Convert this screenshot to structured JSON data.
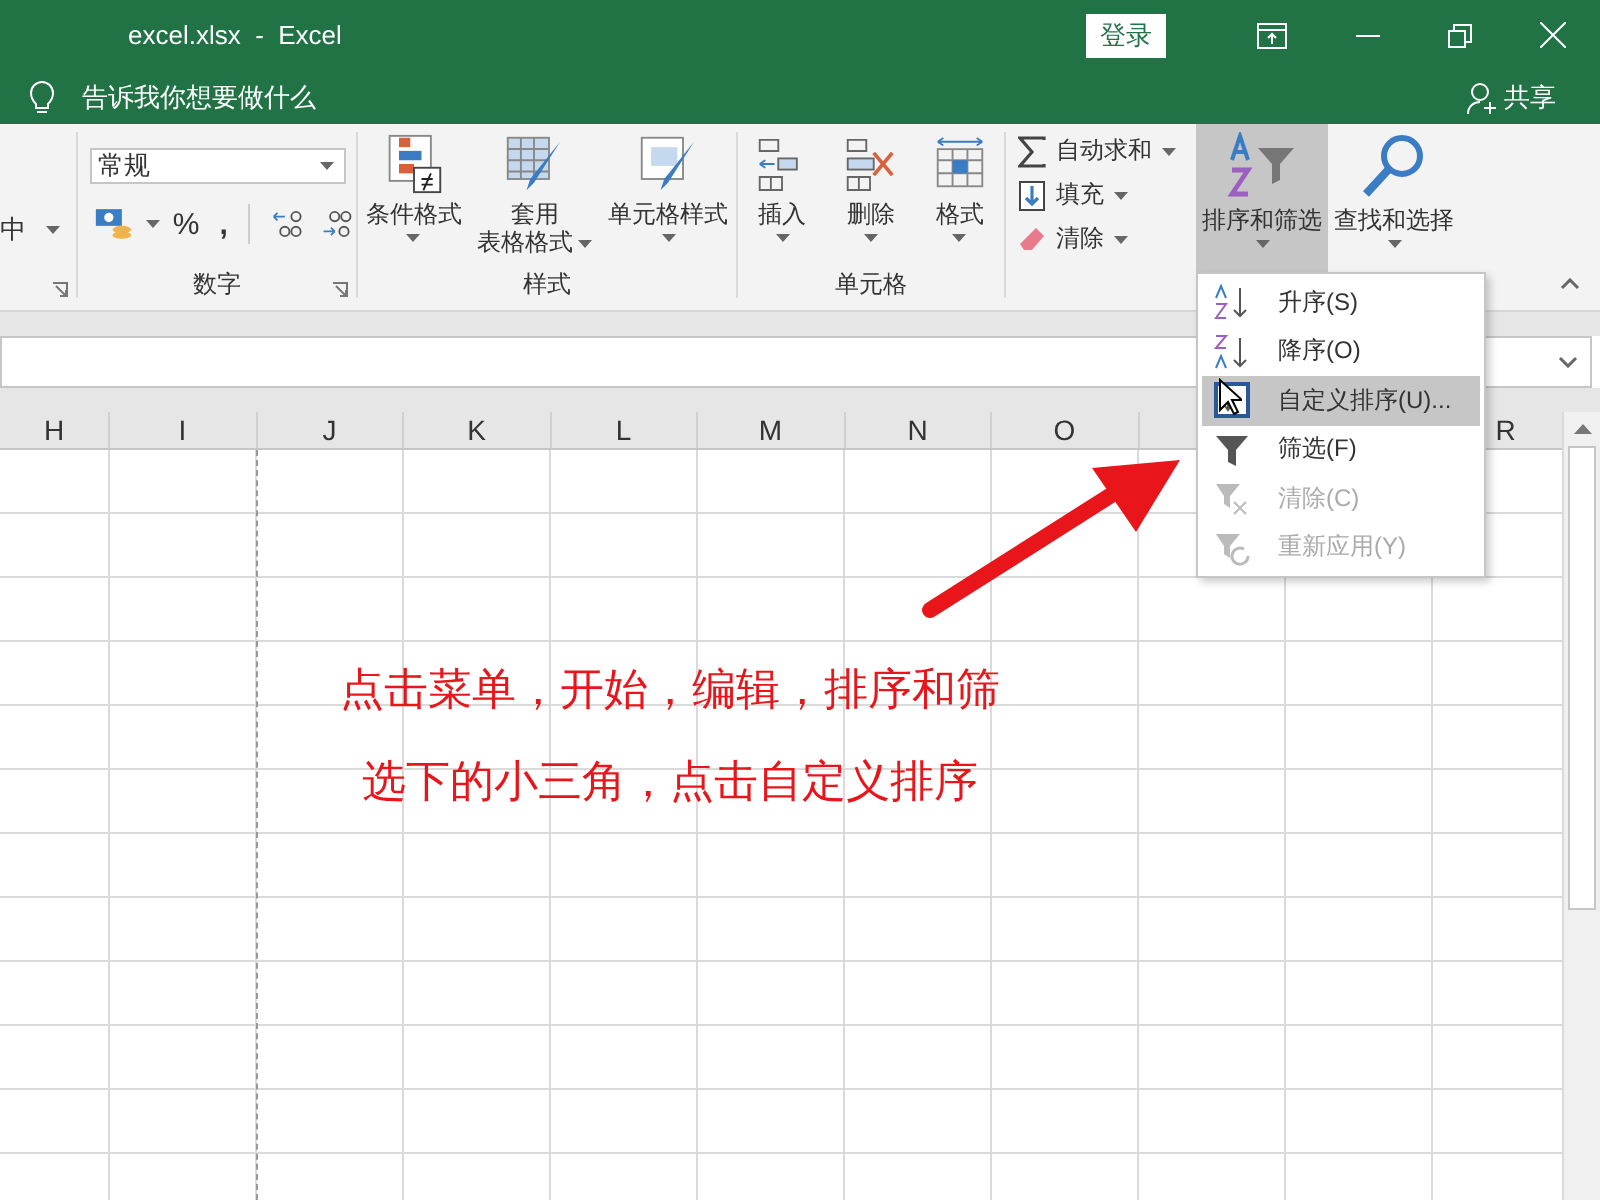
{
  "window": {
    "title": "excel.xlsx  -  Excel",
    "login_button": "登录"
  },
  "tell_me": {
    "placeholder": "告诉我你想要做什么",
    "share": "共享"
  },
  "ribbon": {
    "partial_group": {
      "label": "中"
    },
    "number_group": {
      "label": "数字",
      "format": "常规",
      "percent": "%",
      "comma": ","
    },
    "styles_group": {
      "label": "样式",
      "buttons": [
        {
          "lines": [
            "条件格式"
          ],
          "kind": "conditional"
        },
        {
          "lines": [
            "套用",
            "表格格式"
          ],
          "kind": "table"
        },
        {
          "lines": [
            "单元格样式"
          ],
          "kind": "cellstyle"
        }
      ]
    },
    "cells_group": {
      "label": "单元格",
      "buttons": [
        {
          "lines": [
            "插入"
          ],
          "kind": "insert"
        },
        {
          "lines": [
            "删除"
          ],
          "kind": "delete"
        },
        {
          "lines": [
            "格式"
          ],
          "kind": "format"
        }
      ]
    },
    "editing_group": {
      "small_buttons": [
        {
          "label": "自动求和",
          "kind": "sum"
        },
        {
          "label": "填充",
          "kind": "fill"
        },
        {
          "label": "清除",
          "kind": "clear"
        }
      ],
      "big_buttons": [
        {
          "lines": [
            "排序和筛选"
          ],
          "kind": "sort",
          "selected": true
        },
        {
          "lines": [
            "查找和选择"
          ],
          "kind": "find",
          "selected": false
        }
      ]
    }
  },
  "columns": [
    {
      "label": "H"
    },
    {
      "label": "I"
    },
    {
      "label": "J"
    },
    {
      "label": "K"
    },
    {
      "label": "L"
    },
    {
      "label": "M"
    },
    {
      "label": "N"
    },
    {
      "label": "O"
    },
    {
      "label": "R"
    }
  ],
  "sort_menu": [
    {
      "label": "升序(S)",
      "kind": "asc",
      "selected": false,
      "disabled": false
    },
    {
      "label": "降序(O)",
      "kind": "desc",
      "selected": false,
      "disabled": false
    },
    {
      "label": "自定义排序(U)...",
      "kind": "custom",
      "selected": true,
      "disabled": false
    },
    {
      "label": "筛选(F)",
      "kind": "filter",
      "selected": false,
      "disabled": false
    },
    {
      "label": "清除(C)",
      "kind": "clear",
      "selected": false,
      "disabled": true
    },
    {
      "label": "重新应用(Y)",
      "kind": "reapply",
      "selected": false,
      "disabled": true
    }
  ],
  "annotation": {
    "lines": [
      "点击菜单，开始，编辑，排序和筛",
      "选下的小三角，点击自定义排序"
    ]
  }
}
